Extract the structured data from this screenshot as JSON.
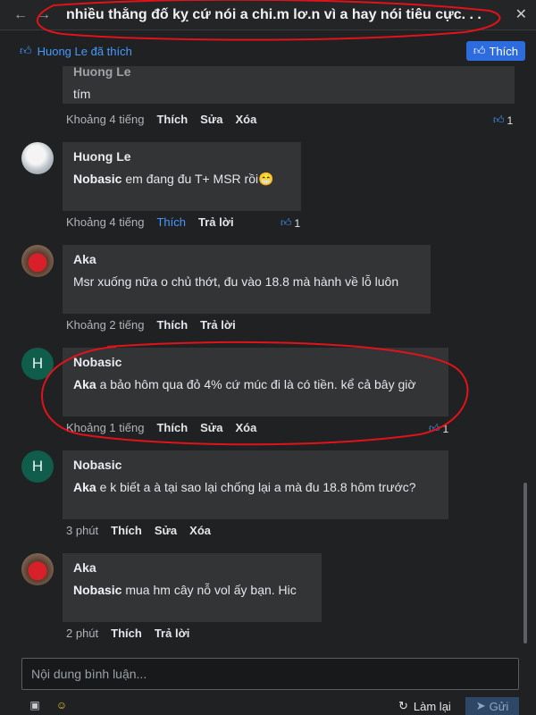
{
  "window": {
    "back_icon": "arrow-left-icon",
    "forward_icon": "arrow-right-icon",
    "title": "nhiều thằng đố kỵ cứ nói a chi.m lơ.n vì a hay nói tiêu cực. . .",
    "close_icon": "close-icon"
  },
  "liked_bar": {
    "text": "Huong Le đã thích",
    "like_button_label": "Thích"
  },
  "comments": [
    {
      "author": "Huong Le",
      "mention": "",
      "text": "tím",
      "time": "Khoảng 4 tiếng",
      "actions": [
        "Thích",
        "Sửa",
        "Xóa"
      ],
      "likes": "1"
    },
    {
      "author": "Huong Le",
      "mention": "Nobasic",
      "text": "em đang đu T+ MSR rồi😁",
      "time": "Khoảng 4 tiếng",
      "actions": [
        "Thích",
        "Trả lời"
      ],
      "likes": "1"
    },
    {
      "author": "Aka",
      "mention": "",
      "text": "Msr xuống nữa o chủ thớt, đu vào 18.8 mà hành về lỗ luôn",
      "time": "Khoảng 2 tiếng",
      "actions": [
        "Thích",
        "Trả lời"
      ],
      "likes": ""
    },
    {
      "author": "Nobasic",
      "avatar_letter": "H",
      "mention": "Aka",
      "text": "a bảo hôm qua đỏ 4% cứ múc đi là có tiền. kể cả bây giờ",
      "time": "Khoảng 1 tiếng",
      "actions": [
        "Thích",
        "Sửa",
        "Xóa"
      ],
      "likes": "1"
    },
    {
      "author": "Nobasic",
      "avatar_letter": "H",
      "mention": "Aka",
      "text": "e k biết a à tại sao lại chống lại a mà đu 18.8 hôm trước?",
      "time": "3 phút",
      "actions": [
        "Thích",
        "Sửa",
        "Xóa"
      ],
      "likes": ""
    },
    {
      "author": "Aka",
      "mention": "Nobasic",
      "text": "mua hm cây nỗ vol ấy bạn. Hic",
      "time": "2 phút",
      "actions": [
        "Thích",
        "Trả lời"
      ],
      "likes": ""
    }
  ],
  "composer": {
    "placeholder": "Nội dung bình luận...",
    "refresh_label": "Làm lại",
    "send_label": "Gửi"
  },
  "colors": {
    "accent": "#4599ff",
    "annotation": "#e0131a",
    "bubble": "#333436",
    "background": "#202122"
  }
}
